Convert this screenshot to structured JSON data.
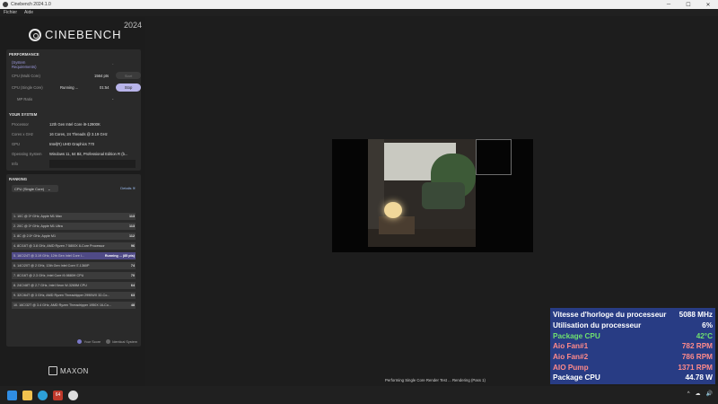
{
  "window": {
    "title": "Cinebench 2024.1.0",
    "minimize": "─",
    "maximize": "☐",
    "close": "✕"
  },
  "menu": [
    "Fichier",
    "Aide"
  ],
  "logo": {
    "text": "CINEBENCH",
    "year": "2024"
  },
  "performance": {
    "title": "PERFORMANCE",
    "sysreq": "(System Requirements)",
    "sysreq_dash": "-",
    "rows": [
      {
        "label": "CPU (Multi Core)",
        "value": "1564 pts",
        "button": "Start"
      },
      {
        "label": "CPU (Single Core)",
        "value": "Running ...",
        "time": "01:54",
        "button": "Stop"
      },
      {
        "label": "MP Ratio",
        "value": "-"
      }
    ]
  },
  "system": {
    "title": "YOUR SYSTEM",
    "rows": [
      {
        "label": "Processor",
        "value": "12th Gen Intel Core i9-12900K"
      },
      {
        "label": "Cores x GHz",
        "value": "16 Cores, 24 Threads @ 3.19 GHz"
      },
      {
        "label": "GPU",
        "value": "Intel(R) UHD Graphics 770"
      },
      {
        "label": "Operating System",
        "value": "Windows 11, 64 Bit, Professional Edition R (b..."
      },
      {
        "label": "Info",
        "value": ""
      }
    ]
  },
  "ranking": {
    "title": "RANKING",
    "dropdown": "CPU (Single Core)",
    "details": "Details",
    "items": [
      {
        "label": "1. 10C @ 3* GHz, Apple M1 Max",
        "score": "113"
      },
      {
        "label": "2. 20C @ 3* GHz, Apple M1 Ultra",
        "score": "113"
      },
      {
        "label": "3. 8C @ 2.5* GHz, Apple M1",
        "score": "112"
      },
      {
        "label": "4. 8C/16T @ 3.8 GHz, AMD Ryzen 7 5800X 8-Core Processor",
        "score": "96"
      },
      {
        "label": "5. 16C/24T @ 3.19 GHz, 12th Gen Intel Core i...",
        "score": "Running ... (85 pts)",
        "active": true
      },
      {
        "label": "6. 14C/20T @ 2 GHz, 13th Gen Intel Core i7-1360P",
        "score": "74"
      },
      {
        "label": "7. 8C/16T @ 2.3 GHz, Intel Core i9-9880H CPU",
        "score": "70"
      },
      {
        "label": "8. 24C/48T @ 2.7 GHz, Intel Xeon W-3265M CPU",
        "score": "64"
      },
      {
        "label": "9. 32C/64T @ 3 GHz, AMD Ryzen Threadripper 2990WX 32-Co...",
        "score": "63"
      },
      {
        "label": "10. 16C/32T @ 3.4 GHz, AMD Ryzen Threadripper 1950X 16-Co...",
        "score": "48"
      }
    ],
    "legend_your": "Your Score",
    "legend_identical": "Identical System",
    "color_your": "#7a78c9",
    "color_identical": "#666666"
  },
  "maxon": "MAXON",
  "status": "Performing Single Core Render Test ... Rendering (Pass 1)",
  "overlay": [
    {
      "label": "Vitesse d'horloge du processeur",
      "value": "5088 MHz",
      "color": "#ffffff"
    },
    {
      "label": "Utilisation du processeur",
      "value": "6%",
      "color": "#ffffff"
    },
    {
      "label": "Package CPU",
      "value": "42°C",
      "color": "#6fe06f"
    },
    {
      "label": "Aio Fan#1",
      "value": "782 RPM",
      "color": "#ff8a8a"
    },
    {
      "label": "Aio Fan#2",
      "value": "786 RPM",
      "color": "#ff8a8a"
    },
    {
      "label": "AIO Pump",
      "value": "1371 RPM",
      "color": "#ff8a8a"
    },
    {
      "label": "Package CPU",
      "value": "44.78 W",
      "color": "#ffffff"
    }
  ],
  "taskbar": {
    "icons": [
      "windows-icon",
      "file-explorer-icon",
      "edge-icon",
      "hwinfo-icon",
      "cinebench-icon"
    ],
    "badge": "64",
    "tray": [
      "^",
      "☁",
      "🔊"
    ]
  }
}
